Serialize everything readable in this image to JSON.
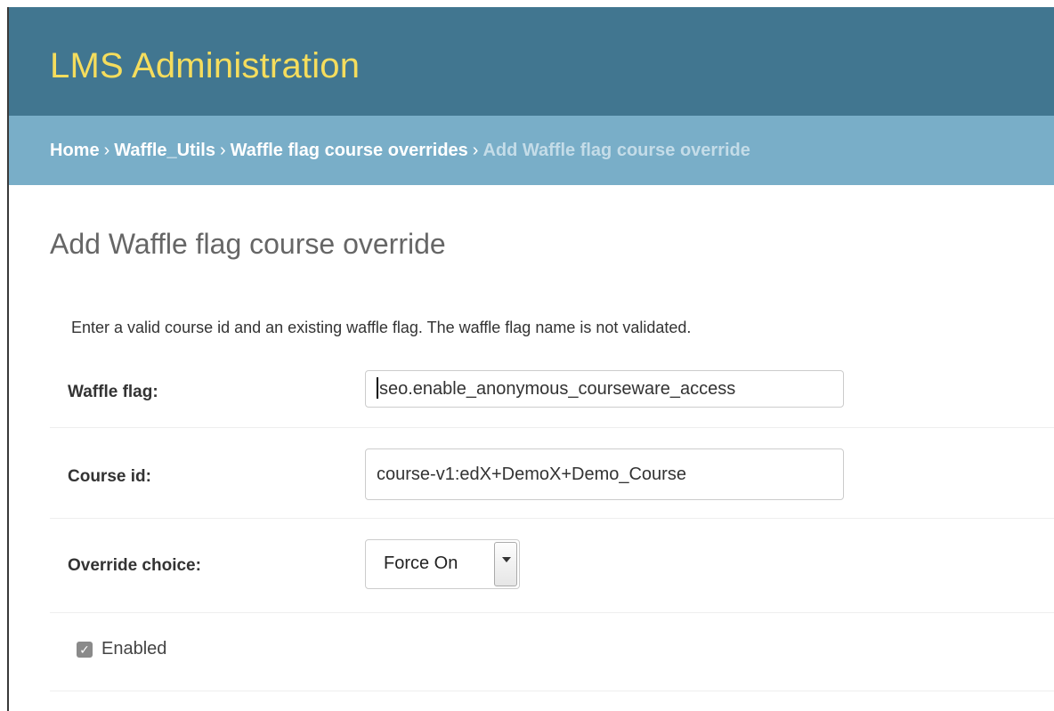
{
  "header": {
    "title": "LMS Administration"
  },
  "breadcrumbs": {
    "items": [
      "Home",
      "Waffle_Utils",
      "Waffle flag course overrides"
    ],
    "current": "Add Waffle flag course override",
    "separator": "›"
  },
  "page": {
    "title": "Add Waffle flag course override",
    "help_text": "Enter a valid course id and an existing waffle flag. The waffle flag name is not validated."
  },
  "form": {
    "waffle_flag": {
      "label": "Waffle flag:",
      "value": "seo.enable_anonymous_courseware_access"
    },
    "course_id": {
      "label": "Course id:",
      "value": "course-v1:edX+DemoX+Demo_Course"
    },
    "override_choice": {
      "label": "Override choice:",
      "selected": "Force On"
    },
    "enabled": {
      "label": "Enabled",
      "checked": true
    }
  },
  "colors": {
    "header_bg": "#417690",
    "header_title": "#f5dd5d",
    "breadcrumbs_bg": "#79aec8",
    "breadcrumbs_current": "#c4dce8"
  },
  "icons": {
    "checkbox": "check-icon",
    "select_arrow": "chevron-down-icon"
  }
}
